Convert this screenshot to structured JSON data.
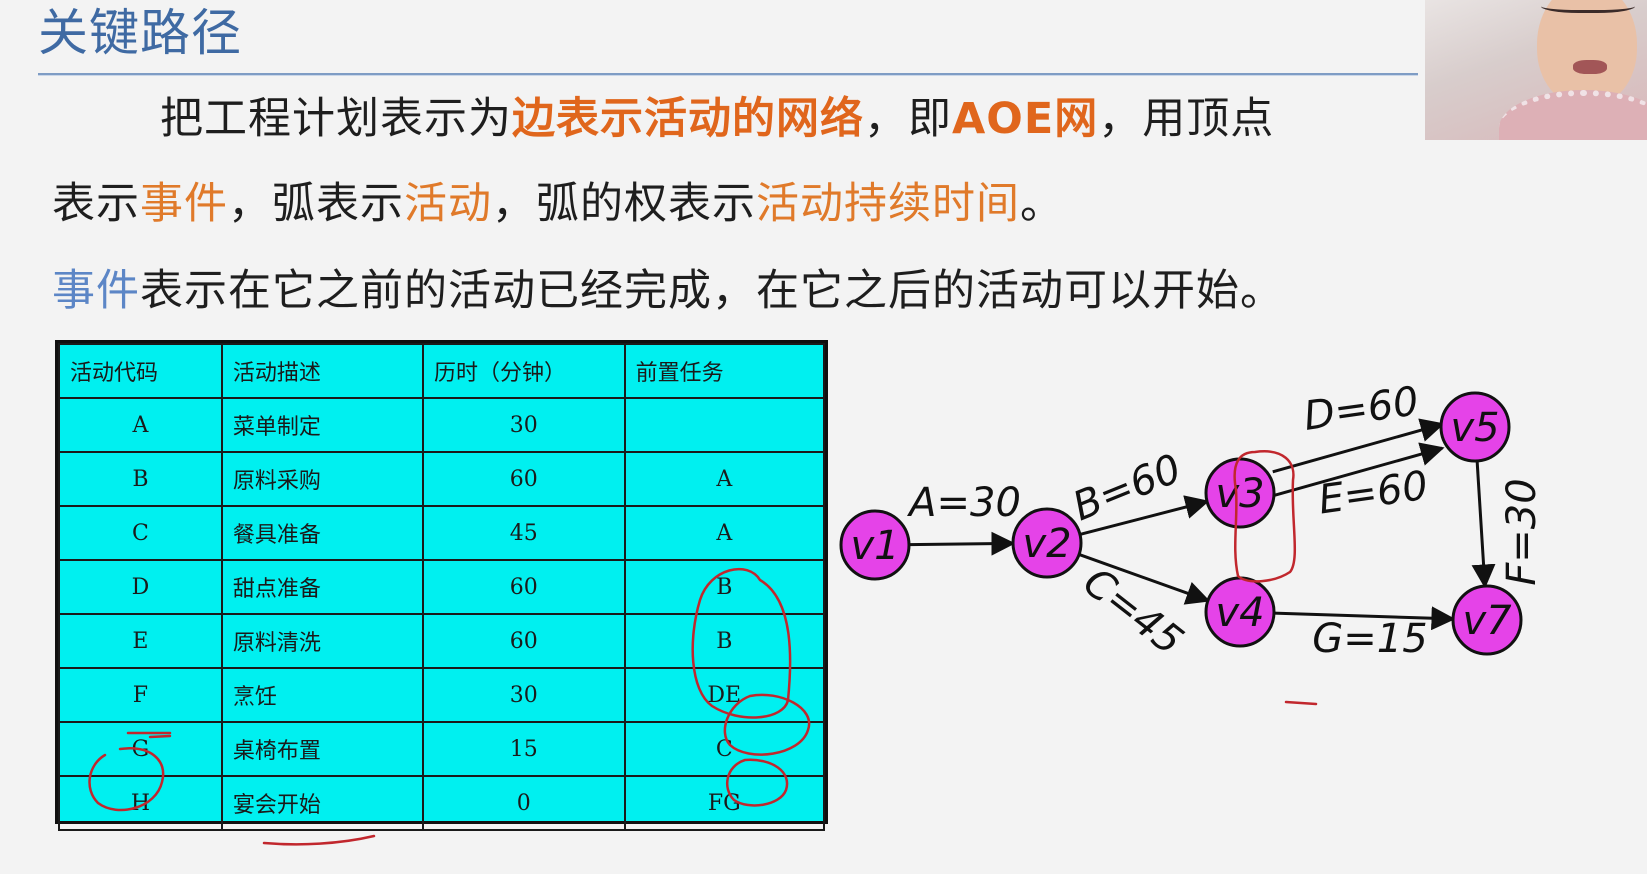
{
  "title": "关键路径",
  "paragraph1": {
    "part1": "把工程计划表示为",
    "part2": "边表示活动的网络",
    "part3": "，即",
    "part4": "AOE网",
    "part5": "，用顶点"
  },
  "paragraph2": {
    "part1": "表示",
    "part2": "事件",
    "part3": "，弧表示",
    "part4": "活动",
    "part5": "，弧的权表示",
    "part6": "活动持续时间",
    "part7": "。"
  },
  "paragraph3": {
    "part1": "事件",
    "part2": "表示在它之前的活动已经完成，在它之后的活动可以开始。"
  },
  "table": {
    "headers": [
      "活动代码",
      "活动描述",
      "历时（分钟）",
      "前置任务"
    ],
    "rows": [
      [
        "A",
        "菜单制定",
        "30",
        ""
      ],
      [
        "B",
        "原料采购",
        "60",
        "A"
      ],
      [
        "C",
        "餐具准备",
        "45",
        "A"
      ],
      [
        "D",
        "甜点准备",
        "60",
        "B"
      ],
      [
        "E",
        "原料清洗",
        "60",
        "B"
      ],
      [
        "F",
        "烹饪",
        "30",
        "DE"
      ],
      [
        "G",
        "桌椅布置",
        "15",
        "C"
      ],
      [
        "H",
        "宴会开始",
        "0",
        "FG"
      ]
    ]
  },
  "graph": {
    "nodes": [
      "v1",
      "v2",
      "v3",
      "v4",
      "v5",
      "v7"
    ],
    "edges": [
      {
        "from": "v1",
        "to": "v2",
        "label": "A=30"
      },
      {
        "from": "v2",
        "to": "v3",
        "label": "B=60"
      },
      {
        "from": "v2",
        "to": "v4",
        "label": "C=45"
      },
      {
        "from": "v3",
        "to": "v5",
        "label": "D=60"
      },
      {
        "from": "v3",
        "to": "v5",
        "label": "E=60"
      },
      {
        "from": "v5",
        "to": "v7",
        "label": "F=30"
      },
      {
        "from": "v4",
        "to": "v7",
        "label": "G=15"
      }
    ]
  },
  "colors": {
    "title": "#3f6aa3",
    "highlight_orange": "#e07a2a",
    "highlight_blue": "#5c86c6",
    "table_fill": "#00f0f0",
    "node_fill": "#e543e8",
    "annotation_ink": "#c1272d"
  }
}
